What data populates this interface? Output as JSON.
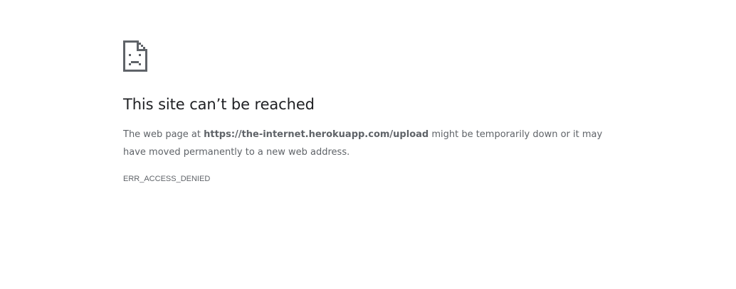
{
  "error": {
    "icon": "sad-page-icon",
    "heading": "This site can’t be reached",
    "description_before": "The web page at ",
    "url": "https://the-internet.herokuapp.com/upload",
    "description_after": " might be temporarily down or it may have moved permanently to a new web address.",
    "code": "ERR_ACCESS_DENIED"
  },
  "colors": {
    "heading": "#202124",
    "body_text": "#5f6368",
    "icon": "#5f6368",
    "background": "#ffffff"
  }
}
